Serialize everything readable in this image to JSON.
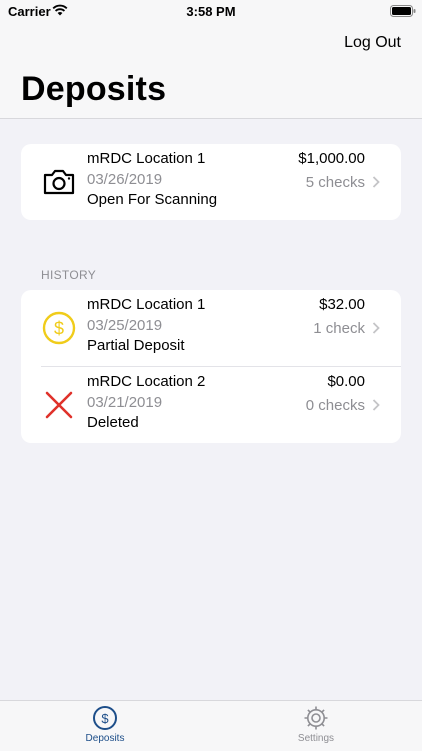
{
  "status_bar": {
    "carrier": "Carrier",
    "time": "3:58 PM"
  },
  "navbar": {
    "logout_label": "Log Out",
    "title": "Deposits"
  },
  "current": {
    "icon": "camera-icon",
    "name": "mRDC Location 1",
    "date": "03/26/2019",
    "status": "Open For Scanning",
    "amount": "$1,000.00",
    "count": "5 checks"
  },
  "history": {
    "header": "HISTORY",
    "items": [
      {
        "icon": "dollar-coin-icon",
        "name": "mRDC Location 1",
        "date": "03/25/2019",
        "status": "Partial Deposit",
        "amount": "$32.00",
        "count": "1 check"
      },
      {
        "icon": "deleted-x-icon",
        "name": "mRDC Location 2",
        "date": "03/21/2019",
        "status": "Deleted",
        "amount": "$0.00",
        "count": "0 checks"
      }
    ]
  },
  "tabbar": {
    "tabs": [
      {
        "label": "Deposits",
        "icon": "dollar-circle-icon",
        "selected": true
      },
      {
        "label": "Settings",
        "icon": "settings-gear-icon",
        "selected": false
      }
    ]
  },
  "colors": {
    "accent": "#1d4e89",
    "coin": "#f0cc1a",
    "delete": "#e0312a",
    "secondary_text": "#8e8e93"
  }
}
